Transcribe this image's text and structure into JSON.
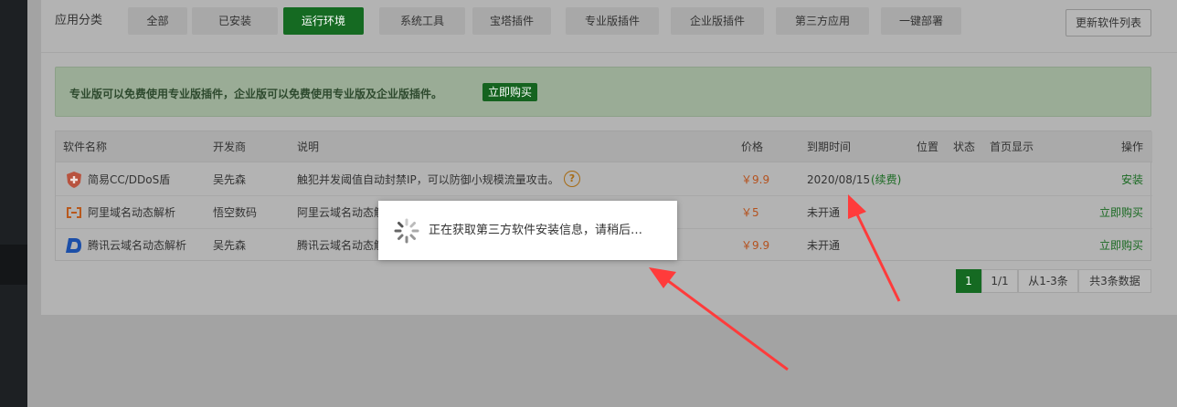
{
  "category": {
    "label": "应用分类",
    "tabs": [
      {
        "label": "全部",
        "active": false
      },
      {
        "label": "已安装",
        "active": false
      },
      {
        "label": "运行环境",
        "active": true
      },
      {
        "label": "系统工具",
        "active": false
      },
      {
        "label": "宝塔插件",
        "active": false
      },
      {
        "label": "专业版插件",
        "active": false
      },
      {
        "label": "企业版插件",
        "active": false
      },
      {
        "label": "第三方应用",
        "active": false
      },
      {
        "label": "一键部署",
        "active": false
      }
    ],
    "refresh_label": "更新软件列表"
  },
  "notice": {
    "text": "专业版可以免费使用专业版插件，企业版可以免费使用专业版及企业版插件。",
    "buy_label": "立即购买"
  },
  "table": {
    "headers": {
      "name": "软件名称",
      "developer": "开发商",
      "desc": "说明",
      "price": "价格",
      "expire": "到期时间",
      "location": "位置",
      "status": "状态",
      "homepage": "首页显示",
      "action": "操作"
    },
    "rows": [
      {
        "name": "简易CC/DDoS盾",
        "developer": "吴先森",
        "desc": "触犯并发阈值自动封禁IP，可以防御小规模流量攻击。",
        "price": "￥9.9",
        "expire": "2020/08/15",
        "renew": "(续费)",
        "action": "安装",
        "icon": "shield-icon"
      },
      {
        "name": "阿里域名动态解析",
        "developer": "悟空数码",
        "desc": "阿里云域名动态解",
        "price": "￥5",
        "expire": "未开通",
        "renew": "",
        "action": "立即购买",
        "icon": "aliyun-icon"
      },
      {
        "name": "腾讯云域名动态解析",
        "developer": "吴先森",
        "desc": "腾讯云域名动态解",
        "price": "￥9.9",
        "expire": "未开通",
        "renew": "",
        "action": "立即购买",
        "icon": "dnspod-icon"
      }
    ]
  },
  "pager": {
    "current": "1",
    "pages": "1/1",
    "range": "从1-3条",
    "total": "共3条数据"
  },
  "loading": {
    "text": "正在获取第三方软件安装信息，请稍后…"
  },
  "colors": {
    "accent": "#20a53a",
    "price": "#f0531d"
  }
}
